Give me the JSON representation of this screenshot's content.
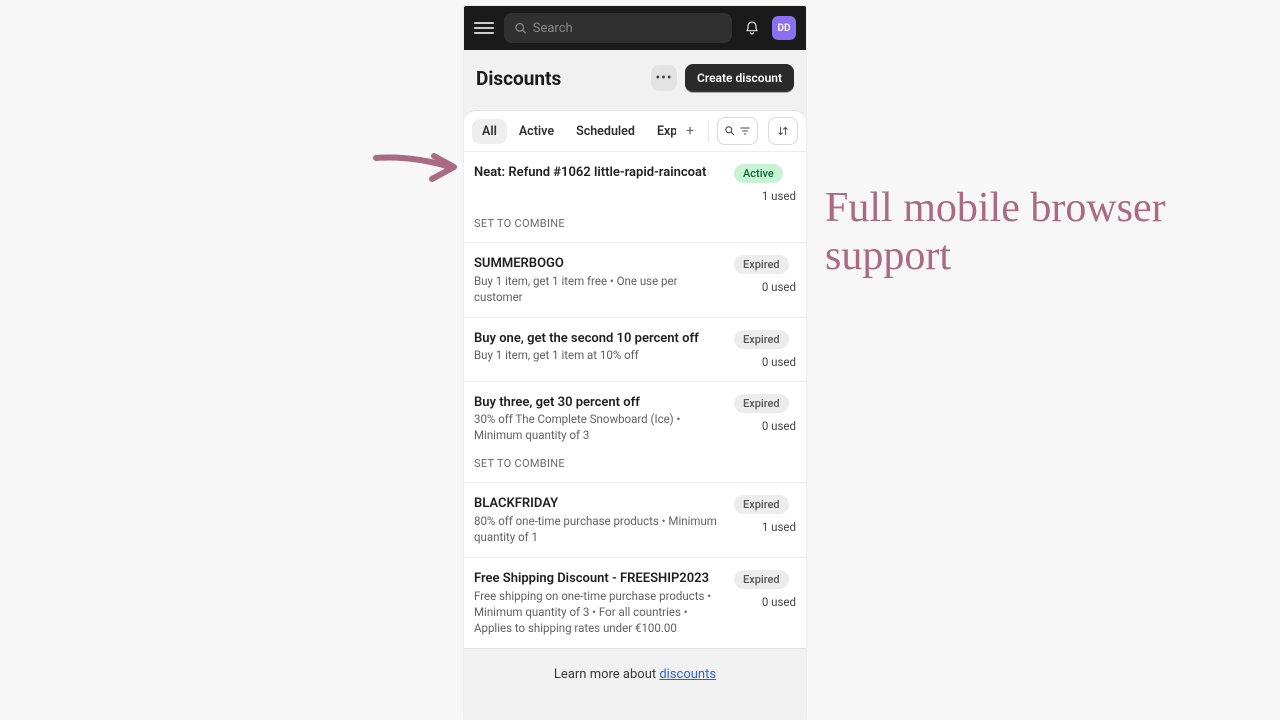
{
  "topbar": {
    "search_placeholder": "Search",
    "avatar_initials": "DD"
  },
  "header": {
    "title": "Discounts",
    "create_label": "Create discount"
  },
  "tabs": {
    "items": [
      "All",
      "Active",
      "Scheduled",
      "Expired"
    ],
    "active_index": 0
  },
  "discounts": [
    {
      "title": "Neat: Refund #1062 little-rapid-raincoat",
      "subtitle": "",
      "status": "Active",
      "status_kind": "active",
      "usage": "1 used",
      "extra": "SET TO COMBINE"
    },
    {
      "title": "SUMMERBOGO",
      "subtitle": "Buy 1 item, get 1 item free • One use per customer",
      "status": "Expired",
      "status_kind": "expired",
      "usage": "0 used",
      "extra": ""
    },
    {
      "title": "Buy one, get the second 10 percent off",
      "subtitle": "Buy 1 item, get 1 item at 10% off",
      "status": "Expired",
      "status_kind": "expired",
      "usage": "0 used",
      "extra": ""
    },
    {
      "title": "Buy three, get 30 percent off",
      "subtitle": "30% off The Complete Snowboard (Ice) • Minimum quantity of 3",
      "status": "Expired",
      "status_kind": "expired",
      "usage": "0 used",
      "extra": "SET TO COMBINE"
    },
    {
      "title": "BLACKFRIDAY",
      "subtitle": "80% off one-time purchase products • Minimum quantity of 1",
      "status": "Expired",
      "status_kind": "expired",
      "usage": "1 used",
      "extra": ""
    },
    {
      "title": "Free Shipping Discount - FREESHIP2023",
      "subtitle": "Free shipping on one-time purchase products • Minimum quantity of 3 • For all countries • Applies to shipping rates under €100.00",
      "status": "Expired",
      "status_kind": "expired",
      "usage": "0 used",
      "extra": ""
    }
  ],
  "footer": {
    "prefix": "Learn more about ",
    "link_label": "discounts"
  },
  "annotation": "Full mobile browser support"
}
